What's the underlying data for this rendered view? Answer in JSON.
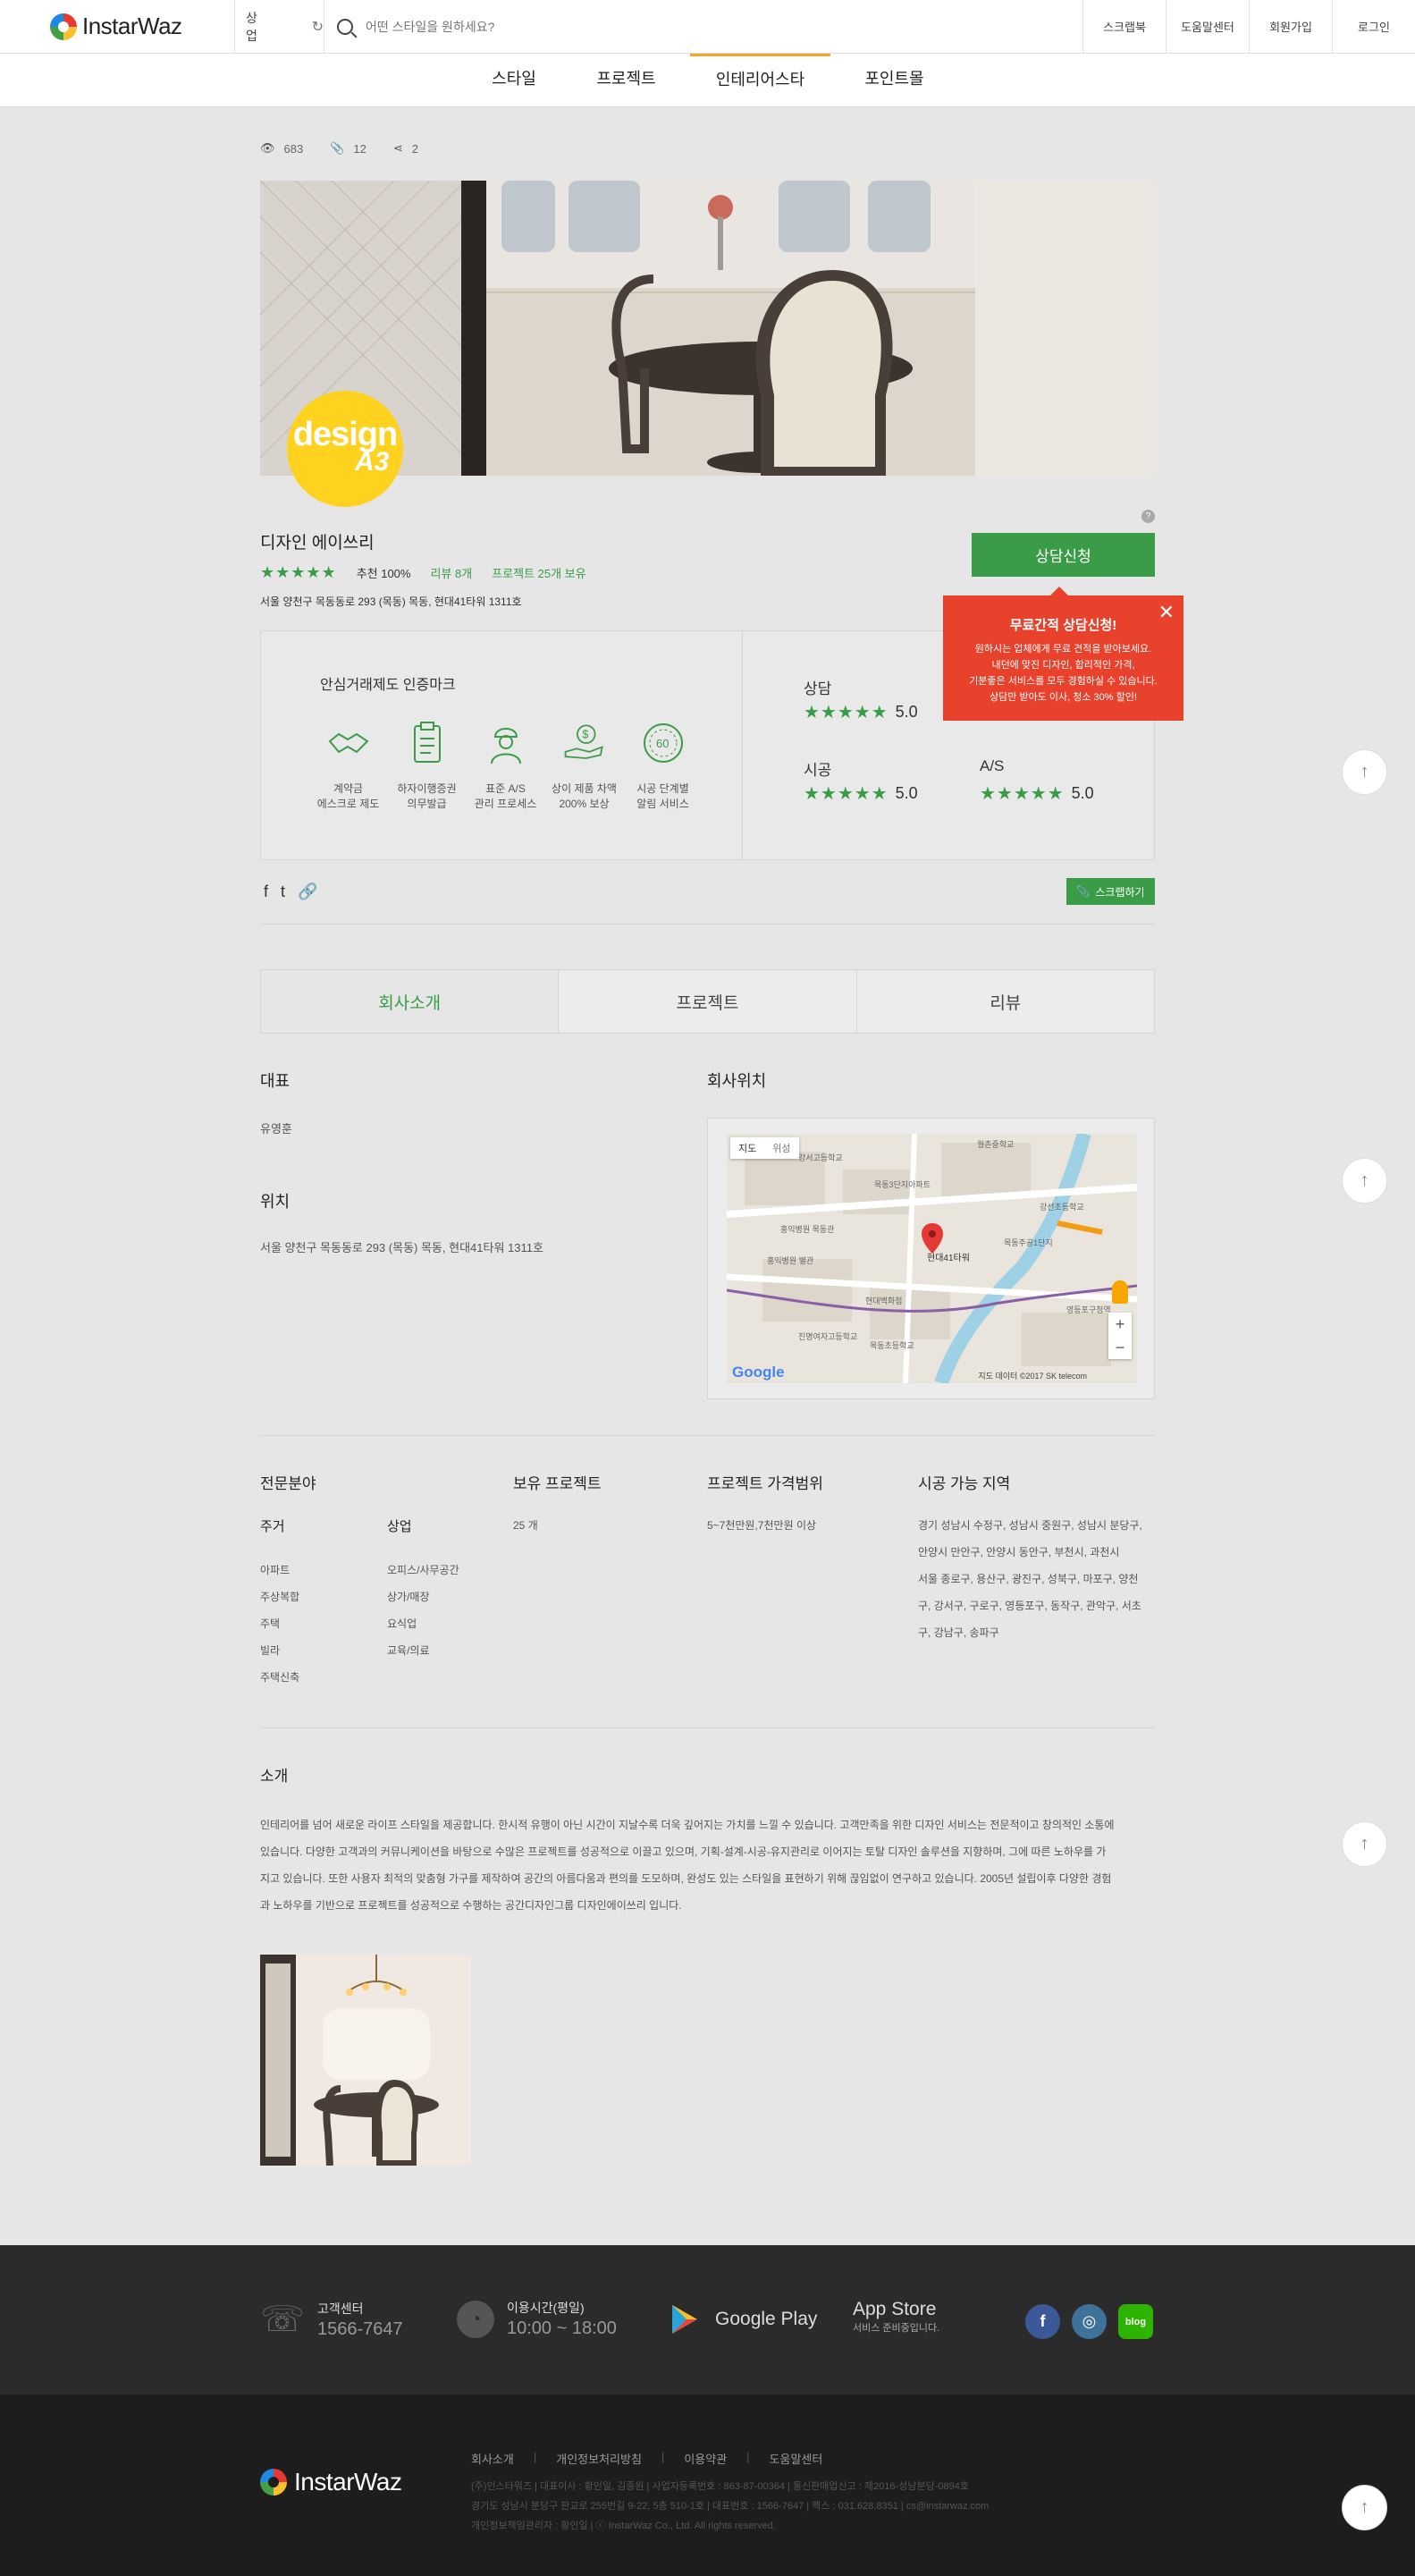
{
  "header": {
    "logo": "InstarWaz",
    "category": "상업",
    "search_placeholder": "어떤 스타일을 원하세요?",
    "nav": [
      "스크랩북",
      "도움말센터",
      "회원가입",
      "로그인"
    ]
  },
  "catnav": [
    "스타일",
    "프로젝트",
    "인테리어스타",
    "포인트몰"
  ],
  "stats": {
    "views": "683",
    "attachments": "12",
    "shares": "2"
  },
  "badge": {
    "text": "design",
    "sub": "A3"
  },
  "company": {
    "name": "디자인 에이쓰리",
    "recommend": "추천 100%",
    "reviews": "리뷰 8개",
    "projects": "프로젝트 25개 보유",
    "address": "서울 양천구 목동동로 293 (목동) 목동, 현대41타워 1311호"
  },
  "consult_button": "상담신청",
  "promo": {
    "title": "무료간적 상담신청!",
    "lines": [
      "원하시는 업체에게 무료 견적을 받아보세요.",
      "내던에 맞진 디자인, 합리적인 가격,",
      "기분좋은 서비스를 모두 경험하실 수 있습니다.",
      "상담만 받아도 이사, 청소 30% 할인!"
    ]
  },
  "cert": {
    "title": "안심거래제도 인증마크",
    "items": [
      {
        "icon": "handshake-icon",
        "l1": "계약금",
        "l2": "에스크로 제도"
      },
      {
        "icon": "clipboard-icon",
        "l1": "하자이행증권",
        "l2": "의무발급"
      },
      {
        "icon": "worker-icon",
        "l1": "표준 A/S",
        "l2": "관리 프로세스"
      },
      {
        "icon": "money-hand-icon",
        "l1": "상이 제품 차액",
        "l2": "200% 보상"
      },
      {
        "icon": "alarm-60-icon",
        "l1": "시공 단계별",
        "l2": "알림 서비스"
      }
    ],
    "scores": [
      {
        "label": "상담",
        "value": "5.0"
      },
      {
        "label": "시공",
        "value": "5.0"
      },
      {
        "label": "A/S",
        "value": "5.0"
      }
    ]
  },
  "scrap_button": "스크랩하기",
  "tabs": [
    "회사소개",
    "프로젝트",
    "리뷰"
  ],
  "info": {
    "ceo_heading": "대표",
    "ceo": "유영훈",
    "location_heading": "위치",
    "location": "서울 양천구 목동동로 293 (목동) 목동, 현대41타워 1311호",
    "map_heading": "회사위치",
    "map_tabs": [
      "지도",
      "위성"
    ],
    "map_google": "Google",
    "map_credit": "지도 데이터 ©2017 SK telecom"
  },
  "specialty": {
    "heading": "전문분야",
    "residential_heading": "주거",
    "residential": [
      "아파트",
      "주상복합",
      "주택",
      "빌라",
      "주택신축"
    ],
    "commercial_heading": "상업",
    "commercial": [
      "오피스/사무공간",
      "상가/매장",
      "요식업",
      "교육/의료"
    ],
    "projects_heading": "보유 프로젝트",
    "projects": "25 개",
    "price_heading": "프로젝트 가격범위",
    "price": "5~7천만원,7천만원 이상",
    "region_heading": "시공 가능 지역",
    "region": [
      "경기 성남시 수정구, 성남시 중원구, 성남시 분당구,",
      "안양시 만안구, 안양시 동안구, 부천시, 과천시",
      "서울 종로구, 용산구, 광진구, 성북구, 마포구, 양천",
      "구, 강서구, 구로구, 영등포구, 동작구, 관악구, 서초",
      "구, 강남구, 송파구"
    ]
  },
  "intro": {
    "heading": "소개",
    "lines": [
      "인테리어를 넘어 새로운 라이프 스타일을 제공합니다. 한시적 유행이 아닌 시간이 지날수록 더욱 깊어지는 가치를 느낄 수 있습니다. 고객만족을 위한 디자인 서비스는 전문적이고 창의적인 소통에",
      "있습니다. 다양한 고객과의 커뮤니케이션을 바탕으로 수많은 프로젝트를 성공적으로 이끌고 있으며, 기획-설계-시공-유지관리로 이어지는 토탈 디자인 솔루션을 지향하며, 그에 따른 노하우를 가",
      "지고 있습니다. 또한 사용자 최적의 맞춤형 가구를 제작하여 공간의 아름다움과 편의를 도모하며, 완성도 있는 스타일을 표현하기 위해 끊임없이 연구하고 있습니다. 2005년 설립이후 다양한 경험",
      "과 노하우를 기반으로 프로젝트를 성공적으로 수행하는 공간디자인그룹 디자인에이쓰리 입니다."
    ]
  },
  "footer": {
    "cs_label": "고객센터",
    "cs_phone": "1566-7647",
    "hours_label": "이용시간(평일)",
    "hours": "10:00 ~ 18:00",
    "google_play": "Google Play",
    "app_store": "App Store",
    "app_store_sub": "서비스 준비중입니다.",
    "links": [
      "회사소개",
      "개인정보처리방침",
      "이용약관",
      "도움말센터"
    ],
    "info_lines": [
      "(주)인스타워즈 | 대표이사 : 황인일, 김종원 | 사업자등록번호 : 863-87-00364 | 통신판매업신고 : 제2016-성남분당-0894호",
      "경기도 성남시 분당구 판교로 255번길 9-22, 5층 510-1호 | 대표번호 : 1566-7647 | 팩스 : 031.628.8351 | cs@instarwaz.com",
      "개인정보책임관리자 : 황인일 | ⓒ InstarWaz Co., Ltd. All rights reserved."
    ],
    "logo": "InstarWaz",
    "social": [
      {
        "icon": "facebook-icon",
        "text": "f",
        "color": "#3b5998"
      },
      {
        "icon": "instagram-icon",
        "text": "◎",
        "color": "#3f729b"
      },
      {
        "icon": "blog-icon",
        "text": "blog",
        "color": "#2db400"
      }
    ]
  },
  "accent_color": "#3b9c48",
  "promo_color": "#e8412c"
}
